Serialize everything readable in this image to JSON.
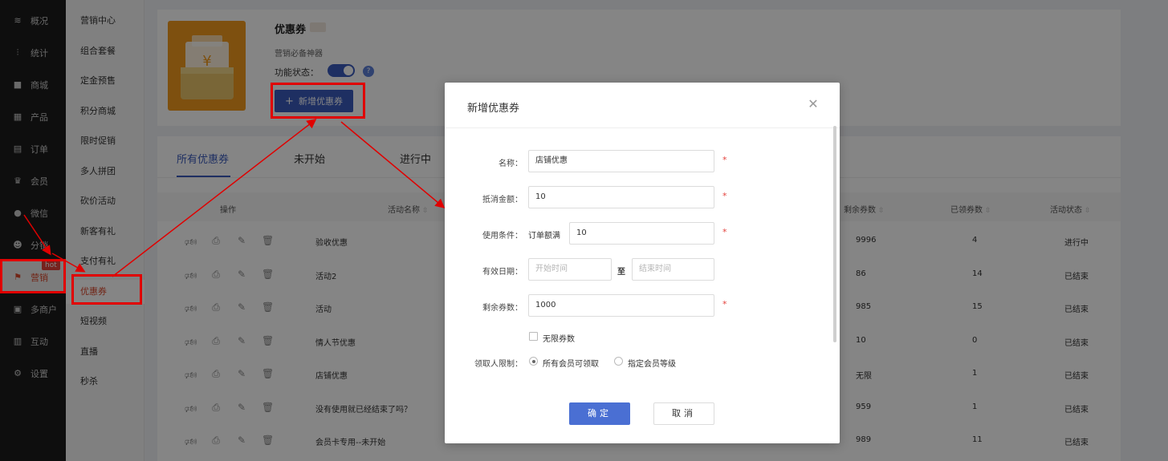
{
  "nav": {
    "items": [
      {
        "label": "概况",
        "icon": "layers-icon",
        "glyph": "≋"
      },
      {
        "label": "统计",
        "icon": "chart-icon",
        "glyph": "⫶"
      },
      {
        "label": "商城",
        "icon": "store-icon",
        "glyph": "■"
      },
      {
        "label": "产品",
        "icon": "grid-icon",
        "glyph": "▦"
      },
      {
        "label": "订单",
        "icon": "clipboard-icon",
        "glyph": "▤"
      },
      {
        "label": "会员",
        "icon": "crown-icon",
        "glyph": "♛"
      },
      {
        "label": "微信",
        "icon": "wechat-icon",
        "glyph": "●"
      },
      {
        "label": "分销",
        "icon": "user-icon",
        "glyph": "☻"
      },
      {
        "label": "营销",
        "icon": "flag-icon",
        "glyph": "⚑"
      },
      {
        "label": "多商户",
        "icon": "shop-icon",
        "glyph": "▣"
      },
      {
        "label": "互动",
        "icon": "interact-icon",
        "glyph": "▥"
      },
      {
        "label": "设置",
        "icon": "settings-icon",
        "glyph": "⚙"
      }
    ],
    "badge": "hot"
  },
  "subnav": {
    "items": [
      "营销中心",
      "组合套餐",
      "定金预售",
      "积分商城",
      "限时促销",
      "多人拼团",
      "砍价活动",
      "新客有礼",
      "支付有礼",
      "优惠券",
      "短视频",
      "直播",
      "秒杀"
    ]
  },
  "header": {
    "title": "优惠券",
    "subtitle": "营销必备神器",
    "status_label": "功能状态：",
    "help": "?",
    "new_button": "新增优惠券",
    "plus": "+"
  },
  "tabs": [
    "所有优惠券",
    "未开始",
    "进行中"
  ],
  "table": {
    "columns": {
      "ops": "操作",
      "name": "活动名称",
      "remain": "剩余券数",
      "claimed": "已领券数",
      "status": "活动状态"
    },
    "sort_glyph": "⇳",
    "op_icons": [
      "🕬",
      "⎙",
      "✎",
      "🗑"
    ],
    "rows": [
      {
        "name": "验收优惠",
        "remain": "9996",
        "claimed": "4",
        "status": "进行中"
      },
      {
        "name": "活动2",
        "remain": "86",
        "claimed": "14",
        "status": "已结束"
      },
      {
        "name": "活动",
        "remain": "985",
        "claimed": "15",
        "status": "已结束"
      },
      {
        "name": "情人节优惠",
        "remain": "10",
        "claimed": "0",
        "status": "已结束"
      },
      {
        "name": "店铺优惠",
        "remain": "无限",
        "claimed": "1",
        "status": "已结束"
      },
      {
        "name": "没有使用就已经结束了吗？",
        "remain": "959",
        "claimed": "1",
        "status": "已结束"
      },
      {
        "name": "会员卡专用--未开始",
        "remain": "989",
        "claimed": "11",
        "status": "已结束"
      }
    ]
  },
  "dialog": {
    "title": "新增优惠券",
    "close": "✕",
    "name_label": "名称：",
    "name_value": "店铺优惠",
    "amount_label": "抵消金额：",
    "amount_value": "10",
    "condition_label": "使用条件：",
    "condition_prefix": "订单额满",
    "condition_value": "10",
    "date_label": "有效日期：",
    "start_placeholder": "开始时间",
    "to": "至",
    "end_placeholder": "结束时间",
    "remain_label": "剩余券数：",
    "remain_value": "1000",
    "unlimited_label": "无限券数",
    "limit_label": "领取人限制：",
    "limit_option_all": "所有会员可领取",
    "limit_option_level": "指定会员等级",
    "required": "*",
    "ok": "确定",
    "cancel": "取消"
  },
  "colors": {
    "primary": "#3b5bbd",
    "active_nav": "#d9472b",
    "annotation": "#e00000",
    "logo": "#f29a1e"
  }
}
